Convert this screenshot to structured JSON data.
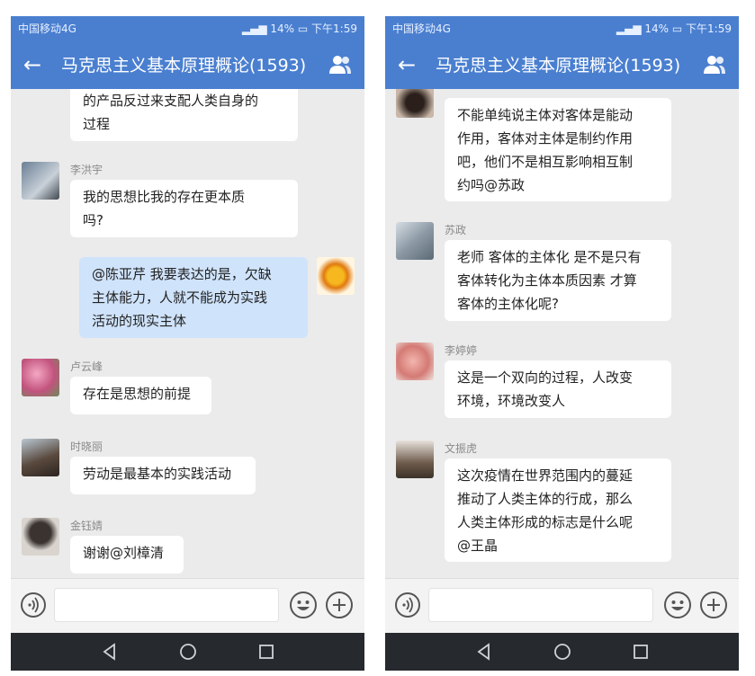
{
  "colors": {
    "header": "#4a7fd0",
    "chat_bg": "#ebebeb",
    "bubble": "#ffffff",
    "my_bubble": "#cfe3fb",
    "navbar": "#26292e"
  },
  "screens": [
    {
      "status": {
        "carrier": "中国移动4G",
        "battery": "14%",
        "time": "下午1:59"
      },
      "title": "马克思主义基本原理概论(1593)",
      "messages": [
        {
          "sender": "",
          "lines": [
            "的产品反过来支配人类自身的",
            "过程"
          ]
        },
        {
          "sender": "李洪宇",
          "lines": [
            "我的思想比我的存在更本质",
            "吗?"
          ]
        },
        {
          "sender": "",
          "lines": [
            "@陈亚芹  我要表达的是，欠缺",
            "主体能力，人就不能成为实践",
            "活动的现实主体"
          ]
        },
        {
          "sender": "卢云峰",
          "lines": [
            "存在是思想的前提"
          ]
        },
        {
          "sender": "时晓丽",
          "lines": [
            "劳动是最基本的实践活动"
          ]
        },
        {
          "sender": "金钰婧",
          "lines": [
            "谢谢@刘樟清"
          ]
        }
      ]
    },
    {
      "status": {
        "carrier": "中国移动4G",
        "battery": "14%",
        "time": "下午1:59"
      },
      "title": "马克思主义基本原理概论(1593)",
      "messages": [
        {
          "sender": "",
          "lines": [
            "不能单纯说主体对客体是能动",
            "作用，客体对主体是制约作用",
            "吧，他们不是相互影响相互制",
            "约吗@苏政"
          ]
        },
        {
          "sender": "苏政",
          "lines": [
            "老师 客体的主体化 是不是只有",
            "客体转化为主体本质因素 才算",
            "客体的主体化呢?"
          ]
        },
        {
          "sender": "李婷婷",
          "lines": [
            "这是一个双向的过程，人改变",
            "环境，环境改变人"
          ]
        },
        {
          "sender": "文振虎",
          "lines": [
            "这次疫情在世界范围内的蔓延",
            "推动了人类主体的行成，那么",
            "人类主体形成的标志是什么呢",
            "@王晶"
          ]
        }
      ]
    }
  ]
}
